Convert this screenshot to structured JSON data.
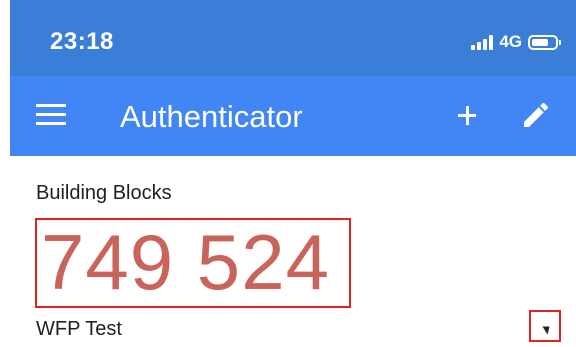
{
  "status_bar": {
    "time": "23:18",
    "network": "4G",
    "icons": [
      "signal-icon",
      "battery-icon"
    ]
  },
  "app_bar": {
    "title": "Authenticator",
    "icons": [
      "menu-icon",
      "add-icon",
      "edit-icon"
    ]
  },
  "account": {
    "issuer": "Building Blocks",
    "code": "749 524",
    "name": "WFP Test",
    "icon": "timer-icon"
  },
  "colors": {
    "status_bar": "#3b7ed8",
    "app_bar": "#4285f4",
    "code": "#c8645a",
    "highlight": "#e02424"
  }
}
